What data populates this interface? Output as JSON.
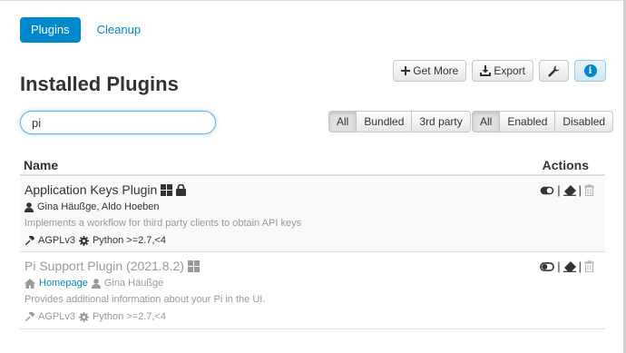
{
  "nav": {
    "tabs": [
      {
        "label": "Plugins",
        "active": true
      },
      {
        "label": "Cleanup",
        "active": false
      }
    ]
  },
  "toolbar": {
    "get_more": "Get More",
    "export": "Export"
  },
  "page_title": "Installed Plugins",
  "search": {
    "value": "pi",
    "placeholder": ""
  },
  "filters": {
    "source": [
      "All",
      "Bundled",
      "3rd party"
    ],
    "source_selected": "All",
    "state": [
      "All",
      "Enabled",
      "Disabled"
    ],
    "state_selected": "All"
  },
  "table": {
    "columns": {
      "name": "Name",
      "actions": "Actions"
    },
    "rows": [
      {
        "name": "Application Keys Plugin",
        "authors": "Gina Häußge, Aldo Hoeben",
        "description": "Implements a workflow for third party clients to obtain API keys",
        "license": "AGPLv3",
        "python": "Python >=2.7,<4",
        "enabled": true,
        "bundled": true,
        "protected": true
      },
      {
        "name": "Pi Support Plugin (2021.8.2)",
        "homepage": "Homepage",
        "authors": "Gina Häußge",
        "description": "Provides additional information about your Pi in the UI.",
        "license": "AGPLv3",
        "python": "Python >=2.7,<4",
        "enabled": false,
        "bundled": true,
        "protected": false
      }
    ]
  },
  "action_separator": "|",
  "colors": {
    "primary": "#0088cc",
    "muted": "#999999",
    "border": "#dddddd"
  }
}
